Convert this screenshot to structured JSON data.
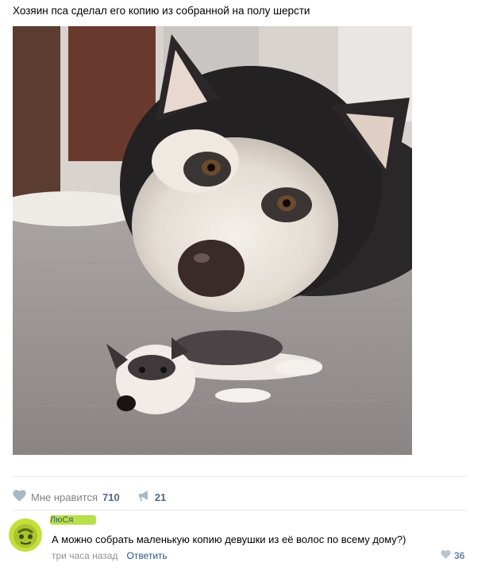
{
  "post": {
    "text": "Хозяин пса сделал его копию из собранной на полу шерсти"
  },
  "actions": {
    "like_label": "Мне нравится",
    "like_count": "710",
    "share_count": "21",
    "like_icon": "heart-icon",
    "share_icon": "megaphone-icon"
  },
  "comment": {
    "author": "ЛюСя",
    "text": "А можно собрать маленькую копию девушки из её волос по всему дому?)",
    "time": "три часа назад",
    "reply_label": "Ответить",
    "like_count": "36"
  },
  "colors": {
    "link": "#2a5885",
    "muted": "#828282",
    "count": "#55677d",
    "author_highlight": "#b8e04a"
  }
}
